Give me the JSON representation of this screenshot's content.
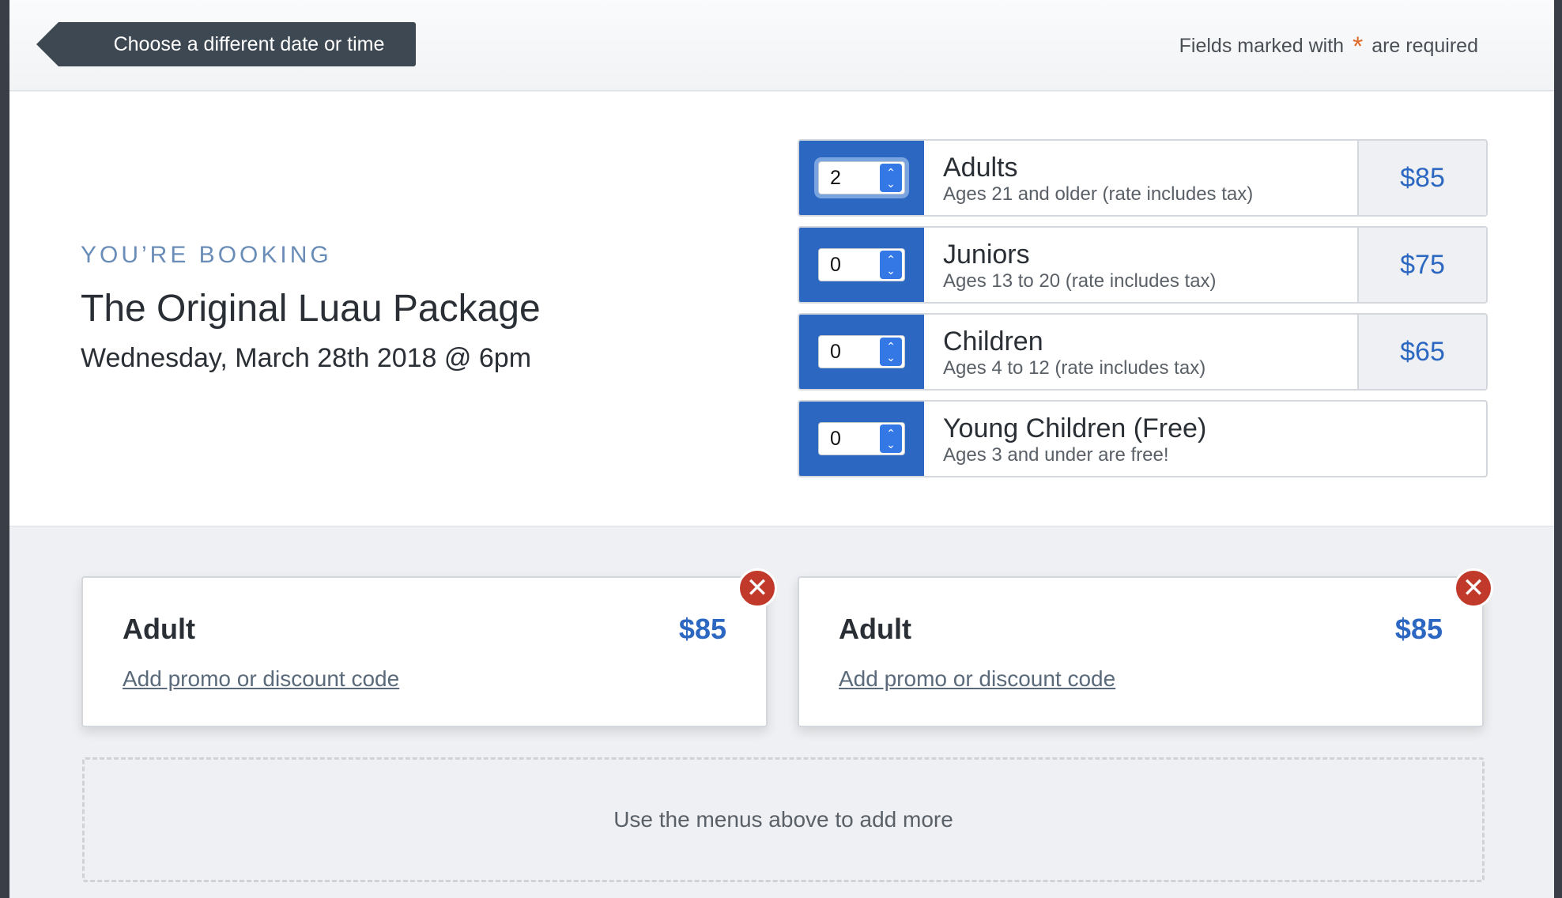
{
  "header": {
    "back_label": "Choose a different date or time",
    "required_prefix": "Fields marked with",
    "required_star": "*",
    "required_suffix": "are required"
  },
  "booking": {
    "label": "YOU’RE BOOKING",
    "package": "The Original Luau Package",
    "date": "Wednesday, March 28th 2018 @ 6pm"
  },
  "tickets": [
    {
      "qty": "2",
      "name": "Adults",
      "desc": "Ages 21 and older (rate includes tax)",
      "price": "$85"
    },
    {
      "qty": "0",
      "name": "Juniors",
      "desc": "Ages 13 to 20 (rate includes tax)",
      "price": "$75"
    },
    {
      "qty": "0",
      "name": "Children",
      "desc": "Ages 4 to 12 (rate includes tax)",
      "price": "$65"
    },
    {
      "qty": "0",
      "name": "Young Children (Free)",
      "desc": "Ages 3 and under are free!",
      "price": ""
    }
  ],
  "cart": [
    {
      "type": "Adult",
      "price": "$85",
      "promo": "Add promo or discount code",
      "remove": "✕"
    },
    {
      "type": "Adult",
      "price": "$85",
      "promo": "Add promo or discount code",
      "remove": "✕"
    }
  ],
  "add_more": "Use the menus above to add more",
  "colors": {
    "accent_blue": "#2c68c1",
    "remove_red": "#c0392b",
    "required_orange": "#e06a2c",
    "back_button": "#3d4852"
  },
  "icons": [
    "back-arrow-icon",
    "stepper-arrows-icon",
    "remove-x-icon"
  ]
}
